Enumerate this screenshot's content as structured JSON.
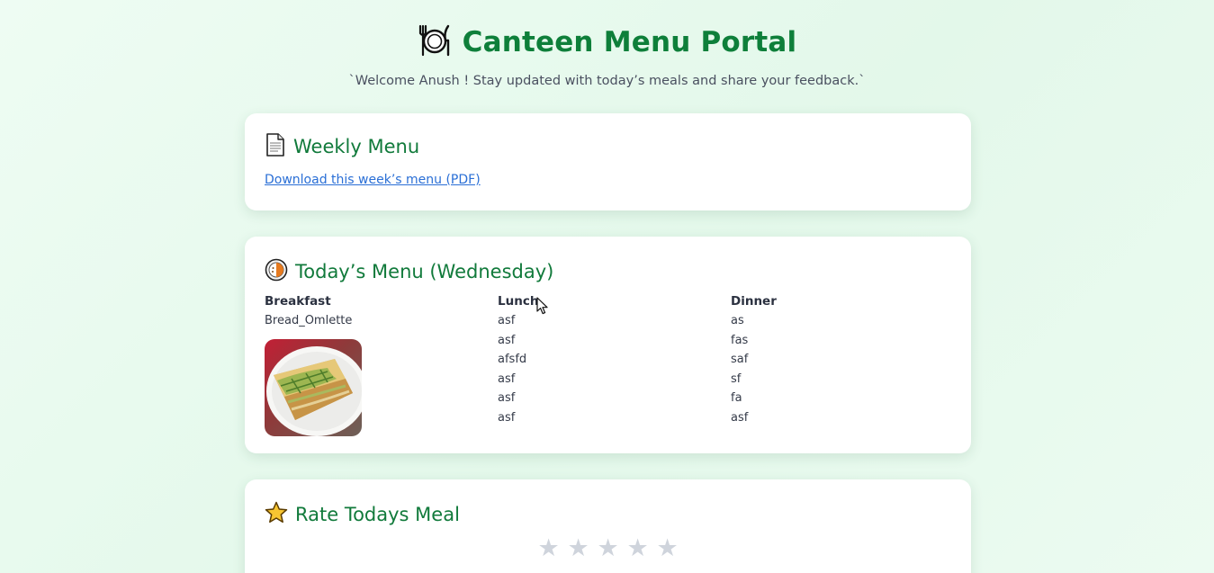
{
  "header": {
    "title": "Canteen Menu Portal",
    "subtitle": "`Welcome Anush ! Stay updated with today’s meals and share your feedback.`",
    "icon": "plate-fork-knife-icon"
  },
  "weekly_menu": {
    "title": "Weekly Menu",
    "icon": "document-icon",
    "download_label": "Download this week’s menu (PDF)"
  },
  "today_menu": {
    "title": "Today’s Menu (Wednesday)",
    "icon": "food-plate-icon",
    "breakfast": {
      "heading": "Breakfast",
      "items": [
        "Bread_Omlette"
      ],
      "image": "bread-omelette-photo"
    },
    "lunch": {
      "heading": "Lunch",
      "items": [
        "asf",
        "asf",
        "afsfd",
        "asf",
        "asf",
        "asf"
      ]
    },
    "dinner": {
      "heading": "Dinner",
      "items": [
        "as",
        "fas",
        "saf",
        "sf",
        "fa",
        "asf"
      ]
    }
  },
  "rating": {
    "title": "Rate Todays Meal",
    "icon": "star-icon",
    "star_glyph": "★",
    "max_stars": 5,
    "selected": 0
  },
  "colors": {
    "accent": "#117a3b",
    "link": "#2a6fd6",
    "star_inactive": "#cfd4dc"
  }
}
